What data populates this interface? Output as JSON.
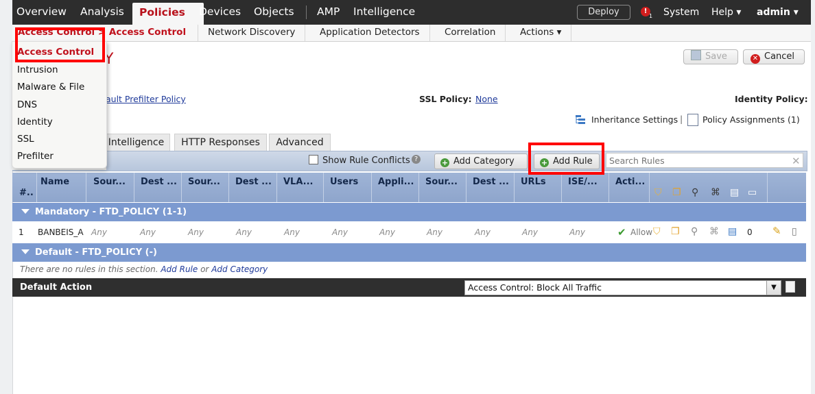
{
  "topnav": {
    "items": [
      "Overview",
      "Analysis",
      "Policies",
      "Devices",
      "Objects",
      "AMP",
      "Intelligence"
    ],
    "deploy_label": "Deploy",
    "alert_count": "1",
    "system_label": "System",
    "help_label": "Help ▾",
    "user_label": "admin ▾"
  },
  "subnav": {
    "items": [
      "Access Control > Access Control",
      "Network Discovery",
      "Application Detectors",
      "Correlation",
      "Actions ▾"
    ]
  },
  "dropdown": {
    "items": [
      "Access Control",
      "Intrusion",
      "Malware & File",
      "DNS",
      "Identity",
      "SSL",
      "Prefilter"
    ]
  },
  "header": {
    "title_fragment": "Y",
    "save_label": "Save",
    "cancel_label": "Cancel",
    "prefilter_link": "ault Prefilter Policy",
    "ssl_label": "SSL Policy:",
    "ssl_value": "None",
    "identity_label": "Identity Policy:",
    "inheritance_label": "Inheritance Settings",
    "assignments_label": "Policy Assignments (1)"
  },
  "tabs": [
    "Intelligence",
    "HTTP Responses",
    "Advanced"
  ],
  "toolbar": {
    "show_conflicts_label": "Show Rule Conflicts",
    "add_category_label": "Add Category",
    "add_rule_label": "Add Rule",
    "search_placeholder": "Search Rules"
  },
  "table": {
    "columns": [
      "#..",
      "Name",
      "Sour...",
      "Dest ...",
      "Sour...",
      "Dest ...",
      "VLA...",
      "Users",
      "Appli...",
      "Sour...",
      "Dest ...",
      "URLs",
      "ISE/...",
      "Acti..."
    ],
    "sections": [
      {
        "title": "Mandatory - FTD_POLICY (1-1)"
      },
      {
        "title": "Default - FTD_POLICY (-)"
      }
    ],
    "rows": [
      {
        "num": "1",
        "name": "BANBEIS_A",
        "cells": [
          "Any",
          "Any",
          "Any",
          "Any",
          "Any",
          "Any",
          "Any",
          "Any",
          "Any",
          "Any",
          "Any"
        ],
        "action": "Allow",
        "count": "0"
      }
    ],
    "empty_text": "There are no rules in this section.",
    "empty_add_rule": "Add Rule",
    "empty_or": "or",
    "empty_add_category": "Add Category"
  },
  "default_action": {
    "label": "Default Action",
    "value": "Access Control: Block All Traffic"
  }
}
